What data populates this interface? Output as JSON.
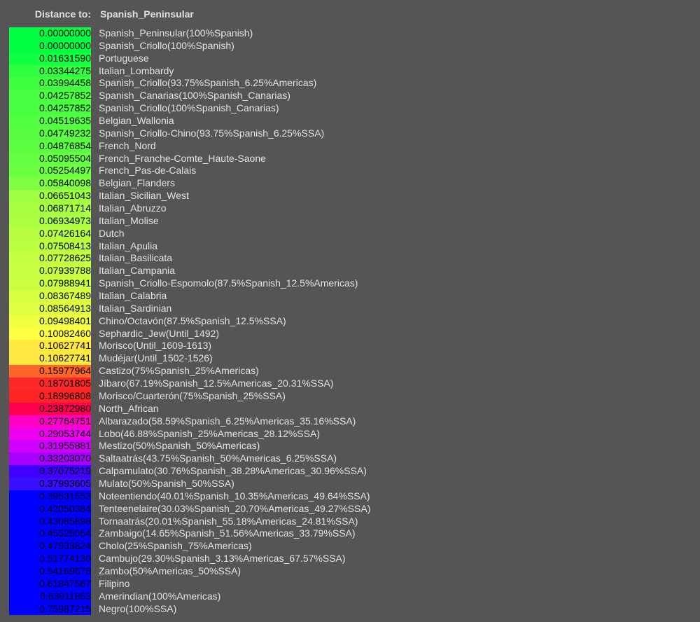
{
  "header": {
    "label": "Distance to:",
    "target": "Spanish_Peninsular"
  },
  "rows": [
    {
      "value": "0.00000000",
      "name": "Spanish_Peninsular(100%Spanish)",
      "color": "#00ff40"
    },
    {
      "value": "0.00000000",
      "name": "Spanish_Criollo(100%Spanish)",
      "color": "#00ff40"
    },
    {
      "value": "0.01631590",
      "name": "Portuguese",
      "color": "#10ff40"
    },
    {
      "value": "0.03344275",
      "name": "Italian_Lombardy",
      "color": "#30ff40"
    },
    {
      "value": "0.03994458",
      "name": "Spanish_Criollo(93.75%Spanish_6.25%Americas)",
      "color": "#40ff40"
    },
    {
      "value": "0.04257852",
      "name": "Spanish_Canarias(100%Spanish_Canarias)",
      "color": "#48ff40"
    },
    {
      "value": "0.04257852",
      "name": "Spanish_Criollo(100%Spanish_Canarias)",
      "color": "#48ff40"
    },
    {
      "value": "0.04519635",
      "name": "Belgian_Wallonia",
      "color": "#50ff40"
    },
    {
      "value": "0.04749232",
      "name": "Spanish_Criollo-Chino(93.75%Spanish_6.25%SSA)",
      "color": "#58ff40"
    },
    {
      "value": "0.04876854",
      "name": "French_Nord",
      "color": "#5cff40"
    },
    {
      "value": "0.05095504",
      "name": "French_Franche-Comte_Haute-Saone",
      "color": "#64ff40"
    },
    {
      "value": "0.05254497",
      "name": "French_Pas-de-Calais",
      "color": "#6aff40"
    },
    {
      "value": "0.05840098",
      "name": "Belgian_Flanders",
      "color": "#80ff40"
    },
    {
      "value": "0.06651043",
      "name": "Italian_Sicilian_West",
      "color": "#a0ff40"
    },
    {
      "value": "0.06871714",
      "name": "Italian_Abruzzo",
      "color": "#a8ff40"
    },
    {
      "value": "0.06934973",
      "name": "Italian_Molise",
      "color": "#aaff40"
    },
    {
      "value": "0.07426164",
      "name": "Dutch",
      "color": "#b8ff40"
    },
    {
      "value": "0.07508413",
      "name": "Italian_Apulia",
      "color": "#bcff40"
    },
    {
      "value": "0.07728625",
      "name": "Italian_Basilicata",
      "color": "#c4ff40"
    },
    {
      "value": "0.07939788",
      "name": "Italian_Campania",
      "color": "#c8ff40"
    },
    {
      "value": "0.07988941",
      "name": "Spanish_Criollo-Espomolo(87.5%Spanish_12.5%Americas)",
      "color": "#caff40"
    },
    {
      "value": "0.08367489",
      "name": "Italian_Calabria",
      "color": "#d8ff40"
    },
    {
      "value": "0.08564913",
      "name": "Italian_Sardinian",
      "color": "#e0ff40"
    },
    {
      "value": "0.09498401",
      "name": "Chino/Octavón(87.5%Spanish_12.5%SSA)",
      "color": "#f0ff40"
    },
    {
      "value": "0.10082460",
      "name": "Sephardic_Jew(Until_1492)",
      "color": "#ffff40"
    },
    {
      "value": "0.10627741",
      "name": "Morisco(Until_1609-1613)",
      "color": "#ffe840"
    },
    {
      "value": "0.10627741",
      "name": "Mudéjar(Until_1502-1526)",
      "color": "#ffe840"
    },
    {
      "value": "0.15977964",
      "name": "Castizo(75%Spanish_25%Americas)",
      "color": "#ff6428"
    },
    {
      "value": "0.18701805",
      "name": "Jíbaro(67.19%Spanish_12.5%Americas_20.31%SSA)",
      "color": "#ff2828"
    },
    {
      "value": "0.18996808",
      "name": "Morisco/Cuarterón(75%Spanish_25%SSA)",
      "color": "#ff2424"
    },
    {
      "value": "0.23872980",
      "name": "North_African",
      "color": "#ff0050"
    },
    {
      "value": "0.27764751",
      "name": "Albarazado(58.59%Spanish_6.25%Americas_35.16%SSA)",
      "color": "#ff00c8"
    },
    {
      "value": "0.29053744",
      "name": "Lobo(46.88%Spanish_25%Americas_28.12%SSA)",
      "color": "#f000f0"
    },
    {
      "value": "0.31955881",
      "name": "Mestizo(50%Spanish_50%Americas)",
      "color": "#d000ff"
    },
    {
      "value": "0.33203070",
      "name": "Saltaatrás(43.75%Spanish_50%Americas_6.25%SSA)",
      "color": "#a800ff"
    },
    {
      "value": "0.37075219",
      "name": "Calpamulato(30.76%Spanish_38.28%Americas_30.96%SSA)",
      "color": "#4000ff"
    },
    {
      "value": "0.37993605",
      "name": "Mulato(50%Spanish_50%SSA)",
      "color": "#3810ff"
    },
    {
      "value": "0.39531553",
      "name": "Noteentiendo(40.01%Spanish_10.35%Americas_49.64%SSA)",
      "color": "#0000ff"
    },
    {
      "value": "0.42050384",
      "name": "Tenteenelaire(30.03%Spanish_20.70%Americas_49.27%SSA)",
      "color": "#0000ff"
    },
    {
      "value": "0.43085898",
      "name": "Tornaatrás(20.01%Spanish_55.18%Americas_24.81%SSA)",
      "color": "#0000ff"
    },
    {
      "value": "0.45525054",
      "name": "Zambaigo(14.65%Spanish_51.56%Americas_33.79%SSA)",
      "color": "#0000ff"
    },
    {
      "value": "0.47933824",
      "name": "Cholo(25%Spanish_75%Americas)",
      "color": "#0000ff"
    },
    {
      "value": "0.51774130",
      "name": "Cambujo(29.30%Spanish_3.13%Americas_67.57%SSA)",
      "color": "#0000ff"
    },
    {
      "value": "0.54169678",
      "name": "Zambo(50%Americas_50%SSA)",
      "color": "#0000ff"
    },
    {
      "value": "0.61847567",
      "name": "Filipino",
      "color": "#0000ff"
    },
    {
      "value": "0.63911853",
      "name": "Amerindian(100%Americas)",
      "color": "#0000ff"
    },
    {
      "value": "0.75987215",
      "name": "Negro(100%SSA)",
      "color": "#0000ff"
    }
  ]
}
